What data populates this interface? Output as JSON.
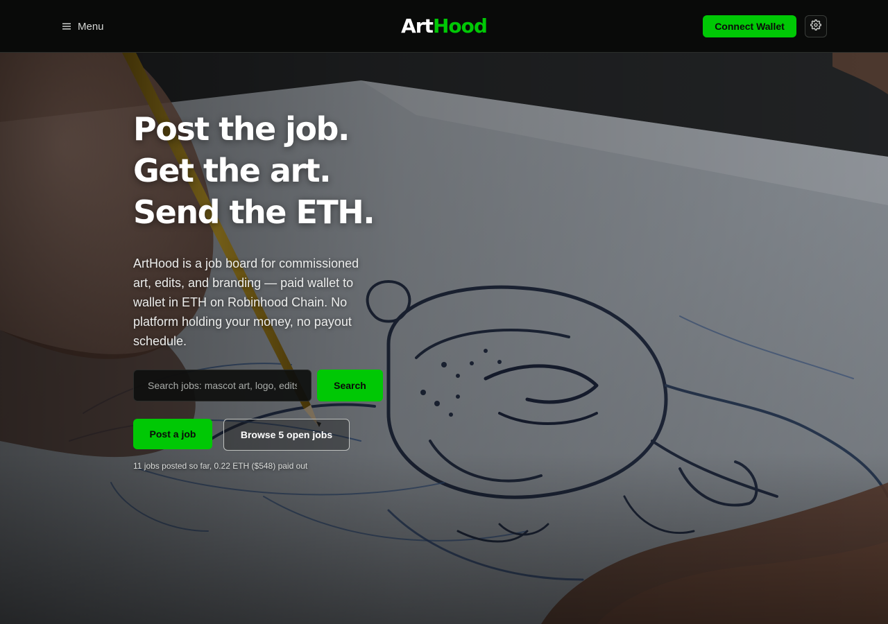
{
  "header": {
    "menu_label": "Menu",
    "logo": {
      "part1": "Art",
      "part2": "Hood"
    },
    "connect_label": "Connect Wallet"
  },
  "hero": {
    "headline": [
      "Post the job.",
      "Get the art.",
      "Send the ETH."
    ],
    "description": "ArtHood is a job board for commissioned art, edits, and branding — paid wallet to wallet in ETH on Robinhood Chain. No platform holding your money, no payout schedule.",
    "search": {
      "placeholder": "Search jobs: mascot art, logo, edits",
      "button_label": "Search"
    },
    "post_label": "Post a job",
    "browse_label": "Browse 5 open jobs",
    "stats": "11 jobs posted so far, 0.22 ETH ($548) paid out"
  },
  "icons": {
    "menu": "menu-icon",
    "settings": "gear-icon"
  },
  "colors": {
    "accent": "#00c805",
    "background": "#090a09",
    "text": "#ffffff"
  }
}
